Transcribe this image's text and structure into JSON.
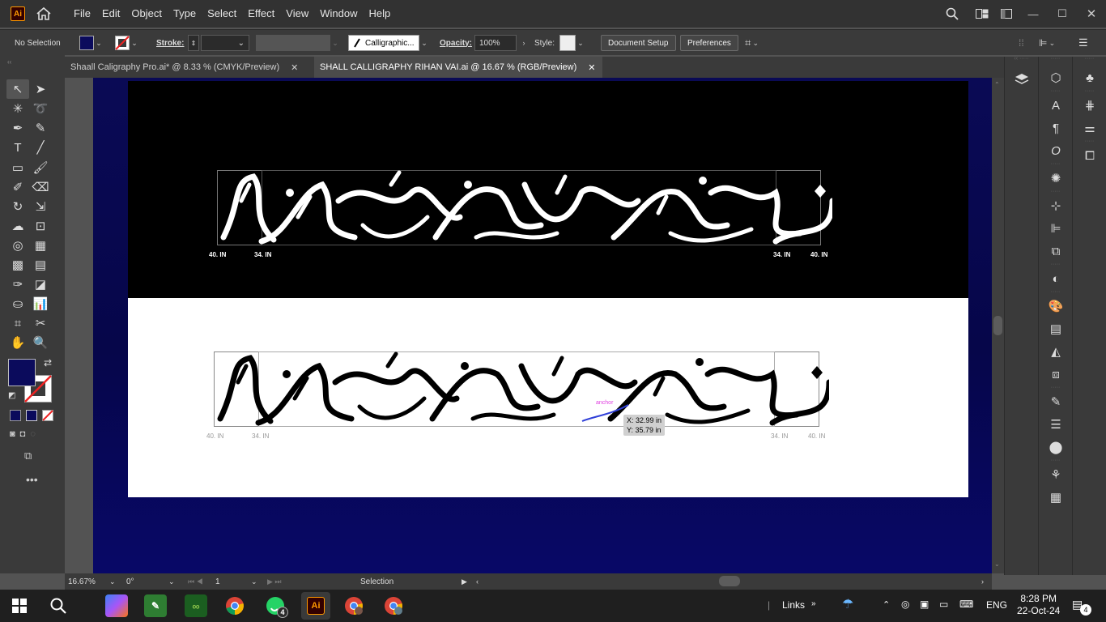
{
  "menubar": {
    "logo": "Ai",
    "items": [
      "File",
      "Edit",
      "Object",
      "Type",
      "Select",
      "Effect",
      "View",
      "Window",
      "Help"
    ]
  },
  "control": {
    "selection": "No Selection",
    "stroke_label": "Stroke:",
    "brush": "Calligraphic...",
    "opacity_label": "Opacity:",
    "opacity_value": "100%",
    "style_label": "Style:",
    "document_setup": "Document Setup",
    "preferences": "Preferences"
  },
  "tabs": [
    {
      "label": "Shaall Caligraphy Pro.ai* @ 8.33 % (CMYK/Preview)"
    },
    {
      "label": "SHALL CALLIGRAPHY RIHAN VAI.ai @ 16.67 % (RGB/Preview)"
    }
  ],
  "artboard": {
    "top_labels": [
      "40. IN",
      "34. IN",
      "34. IN",
      "40. IN"
    ],
    "bottom_labels": [
      "40. IN",
      "34. IN",
      "34. IN",
      "40. IN"
    ],
    "anchor_hint": "anchor",
    "cursor_x": "X: 32.99 in",
    "cursor_y": "Y: 35.79 in"
  },
  "status": {
    "zoom": "16.67%",
    "rotation": "0°",
    "artboard_num": "1",
    "tool": "Selection"
  },
  "taskbar": {
    "links": "Links",
    "lang": "ENG",
    "time": "8:28 PM",
    "date": "22-Oct-24",
    "whatsapp_badge": "4",
    "notif_badge": "4",
    "ai_label": "Ai"
  },
  "colors": {
    "fill": "#0b0b5c",
    "accent": "#ff9a00",
    "canvas_bg": "#0a0a55"
  }
}
